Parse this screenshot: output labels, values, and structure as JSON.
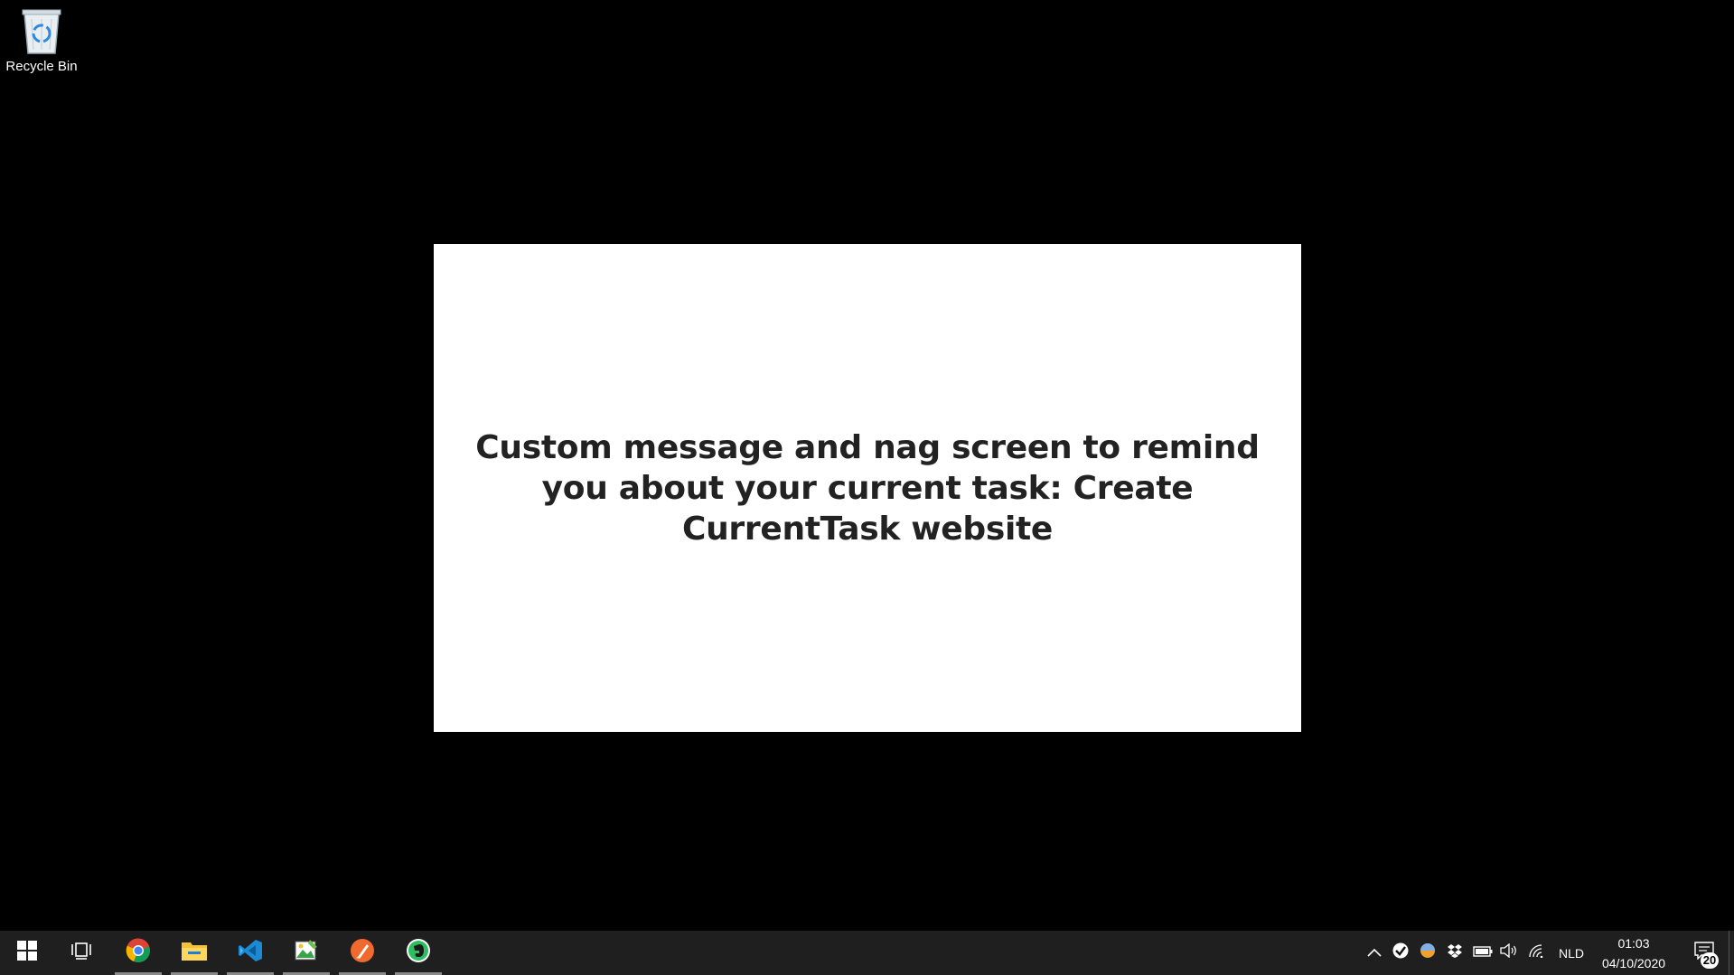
{
  "desktop": {
    "icons": [
      {
        "label": "Recycle Bin",
        "icon": "recycle-bin-icon"
      }
    ]
  },
  "nag_screen": {
    "message": "Custom message and nag screen to remind you about your current task: Create CurrentTask website"
  },
  "taskbar": {
    "start_icon": "windows-logo-icon",
    "task_view_icon": "task-view-icon",
    "pinned_apps": [
      {
        "name": "Google Chrome",
        "icon": "chrome-icon",
        "running": true
      },
      {
        "name": "File Explorer",
        "icon": "folder-icon",
        "running": true
      },
      {
        "name": "Visual Studio Code",
        "icon": "vscode-icon",
        "running": true
      },
      {
        "name": "Image editor",
        "icon": "image-editor-icon",
        "running": true
      },
      {
        "name": "Brush app",
        "icon": "brush-app-icon",
        "running": true
      },
      {
        "name": "Evernote",
        "icon": "evernote-icon",
        "running": true
      }
    ],
    "tray": {
      "icons": [
        "chevron-up-icon",
        "checkmark-icon",
        "color-circle-icon",
        "dropbox-icon",
        "battery-icon",
        "volume-icon",
        "wifi-icon"
      ],
      "language": "NLD",
      "time": "01:03",
      "date": "04/10/2020",
      "notification_count": "20"
    }
  },
  "colors": {
    "desktop_bg": "#000000",
    "taskbar_bg": "#1f1f1f",
    "nag_bg": "#ffffff",
    "nag_text": "#222222"
  }
}
